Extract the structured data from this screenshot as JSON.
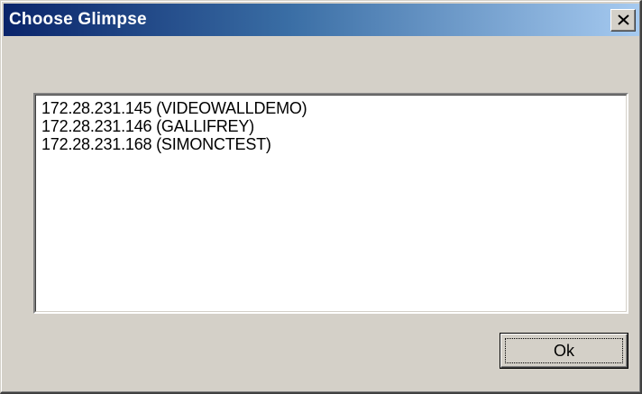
{
  "window": {
    "title": "Choose Glimpse",
    "close_icon": "close-icon"
  },
  "glimpse_list": {
    "items": [
      "172.28.231.145 (VIDEOWALLDEMO)",
      "172.28.231.146 (GALLIFREY)",
      "172.28.231.168 (SIMONCTEST)"
    ]
  },
  "buttons": {
    "ok_label": "Ok"
  },
  "colors": {
    "titlebar_start": "#0a246a",
    "titlebar_end": "#a6caf0",
    "dialog_face": "#d4d0c8"
  }
}
